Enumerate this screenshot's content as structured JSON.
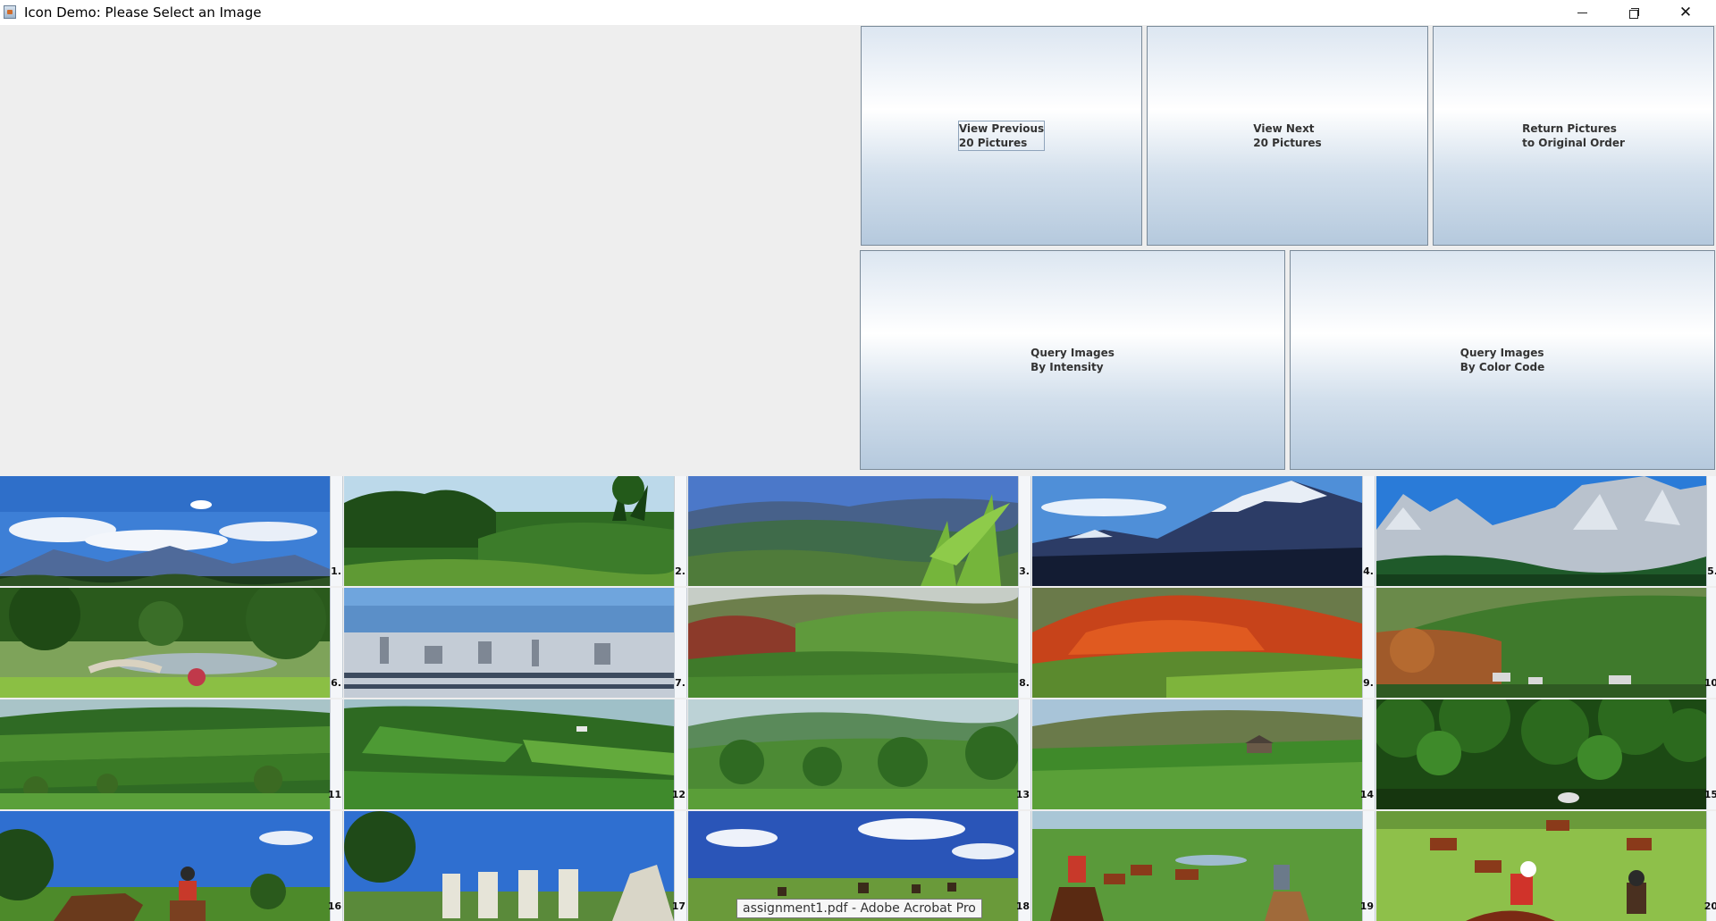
{
  "window": {
    "title": "Icon Demo: Please Select an Image",
    "icon": "java-app-icon",
    "controls": {
      "minimize": "minimize-icon",
      "maximize": "restore-icon",
      "close": "close-icon"
    }
  },
  "buttons": {
    "view_previous": "View Previous\n20 Pictures",
    "view_next": "View Next\n20 Pictures",
    "return_original": "Return Pictures\nto Original Order",
    "query_intensity": "Query Images\nBy Intensity",
    "query_color": "Query Images\nBy Color Code"
  },
  "thumbnails": [
    {
      "label": "1.",
      "scene": "mountains-clouds"
    },
    {
      "label": "2.",
      "scene": "tropical-valley"
    },
    {
      "label": "3.",
      "scene": "forest-hills-palm"
    },
    {
      "label": "4.",
      "scene": "snow-mountain"
    },
    {
      "label": "5.",
      "scene": "rocky-cliffs"
    },
    {
      "label": "6.",
      "scene": "garden-bridge"
    },
    {
      "label": "7.",
      "scene": "city-harbor"
    },
    {
      "label": "8.",
      "scene": "autumn-hills"
    },
    {
      "label": "9.",
      "scene": "red-hills"
    },
    {
      "label": "10",
      "scene": "village-hillside"
    },
    {
      "label": "11",
      "scene": "green-fields"
    },
    {
      "label": "12",
      "scene": "patchwork-hills"
    },
    {
      "label": "13",
      "scene": "green-valley"
    },
    {
      "label": "14",
      "scene": "farm-field"
    },
    {
      "label": "15",
      "scene": "dense-trees"
    },
    {
      "label": "16",
      "scene": "horse-rider"
    },
    {
      "label": "17",
      "scene": "gravestones"
    },
    {
      "label": "18",
      "scene": "riders-sky"
    },
    {
      "label": "19",
      "scene": "cattle-drive"
    },
    {
      "label": "20",
      "scene": "cattle-cowboys"
    }
  ],
  "tooltip": "assignment1.pdf - Adobe Acrobat Pro"
}
